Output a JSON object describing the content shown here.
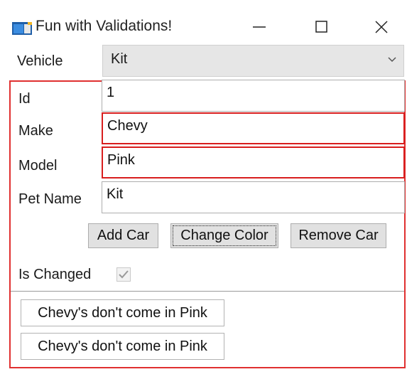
{
  "window": {
    "title": "Fun with Validations!",
    "icon": "app-window-icon",
    "controls": [
      "minimize-icon",
      "maximize-icon",
      "close-icon"
    ]
  },
  "vehicle": {
    "label": "Vehicle",
    "selected": "Kit"
  },
  "form": {
    "id_label": "Id",
    "id_value": "1",
    "make_label": "Make",
    "make_value": "Chevy",
    "model_label": "Model",
    "model_value": "Pink",
    "petname_label": "Pet Name",
    "petname_value": "Kit"
  },
  "buttons": {
    "add_car": "Add Car",
    "change_color": "Change Color",
    "remove_car": "Remove Car"
  },
  "is_changed": {
    "label": "Is Changed",
    "checked": true
  },
  "errors": [
    "Chevy's don't come in Pink",
    "Chevy's don't come in Pink"
  ],
  "colors": {
    "error_border": "#d81e1e",
    "button_bg": "#e1e1e1"
  }
}
